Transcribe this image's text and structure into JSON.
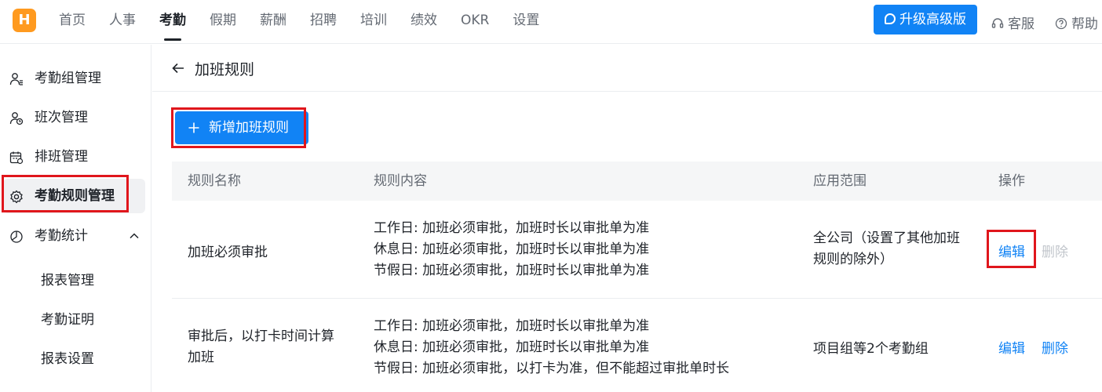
{
  "app": {
    "logo": "H",
    "nav": [
      "首页",
      "人事",
      "考勤",
      "假期",
      "薪酬",
      "招聘",
      "培训",
      "绩效",
      "OKR",
      "设置"
    ],
    "nav_active": "考勤",
    "upgrade_label": "升级高级版",
    "service_label": "客服",
    "help_label": "帮助"
  },
  "sidebar": {
    "items": [
      {
        "label": "考勤组管理",
        "icon": "group-icon"
      },
      {
        "label": "班次管理",
        "icon": "shift-icon"
      },
      {
        "label": "排班管理",
        "icon": "calendar-icon"
      },
      {
        "label": "考勤规则管理",
        "icon": "gear-icon",
        "active": true
      },
      {
        "label": "考勤统计",
        "icon": "pie-chart-icon",
        "expanded": true
      }
    ],
    "sub_items": [
      "报表管理",
      "考勤证明",
      "报表设置"
    ]
  },
  "page": {
    "title": "加班规则",
    "add_button": "新增加班规则"
  },
  "table": {
    "headers": [
      "规则名称",
      "规则内容",
      "应用范围",
      "操作"
    ],
    "rows": [
      {
        "name": [
          "加班必须审批"
        ],
        "content": [
          "工作日: 加班必须审批，加班时长以审批单为准",
          "休息日: 加班必须审批，加班时长以审批单为准",
          "节假日: 加班必须审批，加班时长以审批单为准"
        ],
        "scope": [
          "全公司（设置了其他加班",
          "规则的除外）"
        ],
        "edit": "编辑",
        "delete": "删除",
        "delete_disabled": true
      },
      {
        "name": [
          "审批后，以打卡时间计算",
          "加班"
        ],
        "content": [
          "工作日: 加班必须审批，加班时长以审批单为准",
          "休息日: 加班必须审批，加班时长以审批单为准",
          "节假日: 加班必须审批，以打卡为准，但不能超过审批单时长"
        ],
        "scope": [
          "项目组等2个考勤组"
        ],
        "edit": "编辑",
        "delete": "删除",
        "delete_disabled": false
      }
    ]
  },
  "colors": {
    "primary": "#1183f5",
    "highlight": "#e0161c",
    "logo": "#ff9a1f",
    "text": "#1f2329",
    "muted": "#646a73",
    "disabled": "#c2c6cc"
  }
}
